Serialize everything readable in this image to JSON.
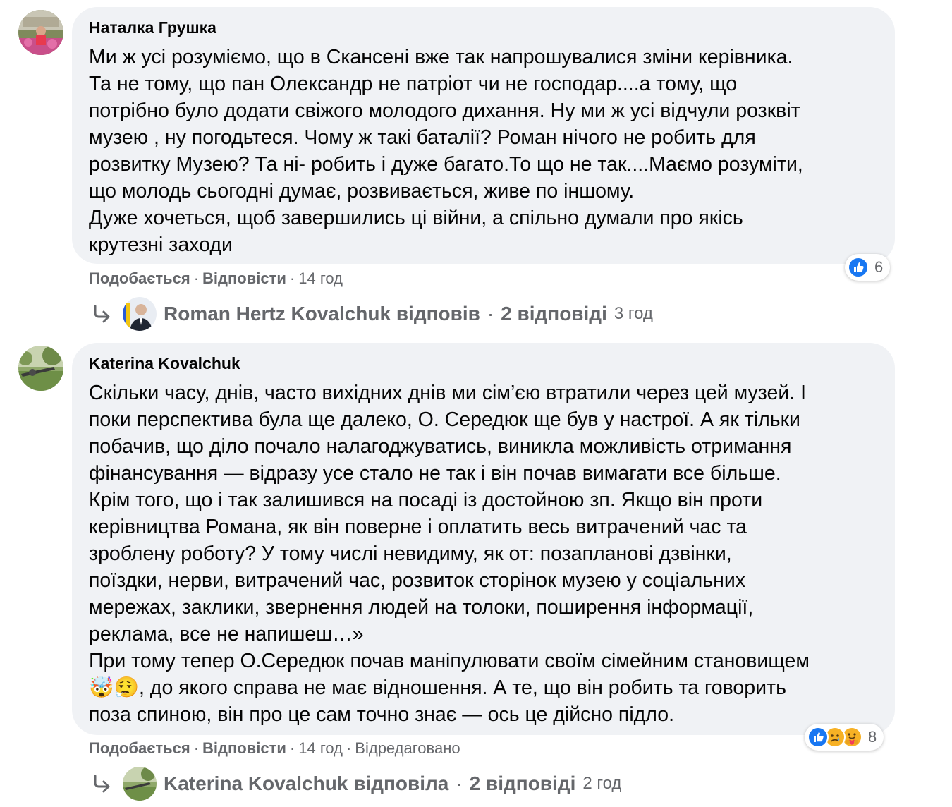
{
  "comments": [
    {
      "author": "Наталка Грушка",
      "lines": [
        "Ми ж усі розуміємо, що в Скансені вже так напрошувалися зміни керівника.",
        "Та не тому, що пан Олександр не патріот чи не господар....а тому, що",
        "потрібно було додати свіжого молодого дихання. Ну ми ж усі відчули розквіт",
        "музею , ну погодьтеся. Чому ж такі баталії? Роман нічого не робить для",
        "розвитку Музею? Та ні- робить і дуже багато.То що не так....Маємо розуміти,",
        "що молодь сьогодні думає, розвивається, живе по іншому.",
        "Дуже хочеться, щоб завершились ці війни, а спільно думали про якісь",
        "крутезні заходи"
      ],
      "like_label": "Подобається",
      "reply_label": "Відповісти",
      "time": "14 год",
      "edited": "",
      "reaction_count": "6",
      "reply_author": "Roman Hertz Kovalchuk відповів",
      "reply_count": "2 відповіді",
      "reply_time": "3 год"
    },
    {
      "author": "Katerina Kovalchuk",
      "lines": [
        "Скільки часу, днів, часто вихідних днів ми сім’єю втратили через цей музей. І",
        "поки перспектива була ще далеко, О. Середюк ще був у настрої. А як тільки",
        "побачив, що діло почало налагоджуватись, виникла можливість отримання",
        "фінансування — відразу усе стало не так і він почав вимагати все більше.",
        "Крім того, що і так залишився на посаді із достойною зп. Якщо він проти",
        "керівництва Романа, як він поверне і оплатить весь витрачений час та",
        "зроблену роботу? У тому числі невидиму, як от: позапланові дзвінки,",
        "поїздки, нерви, витрачений час, розвиток сторінок музею у соціальних",
        "мережах, заклики, звернення людей на толоки, поширення інформації,",
        "реклама, все не напишеш…»",
        "При тому тепер О.Середюк почав маніпулювати своїм сімейним становищем",
        "🤯😮‍💨, до якого справа не має відношення. А те, що він робить та говорить",
        "поза спиною, він про це сам точно знає — ось це дійсно підло."
      ],
      "like_label": "Подобається",
      "reply_label": "Відповісти",
      "time": "14 год",
      "edited": "Відредаговано",
      "reaction_count": "8",
      "reply_author": "Katerina Kovalchuk відповіла",
      "reply_count": "2 відповіді",
      "reply_time": "2 год"
    }
  ],
  "colors": {
    "bubble": "#f0f2f5",
    "secondary_text": "#65676b",
    "like_blue": "#1877f2",
    "care_yellow": "#f7b125"
  },
  "icons": {
    "reply_arrow": "reply-arrow-icon",
    "like": "like-reaction-icon",
    "sad": "sad-reaction-icon",
    "care": "care-reaction-icon"
  }
}
